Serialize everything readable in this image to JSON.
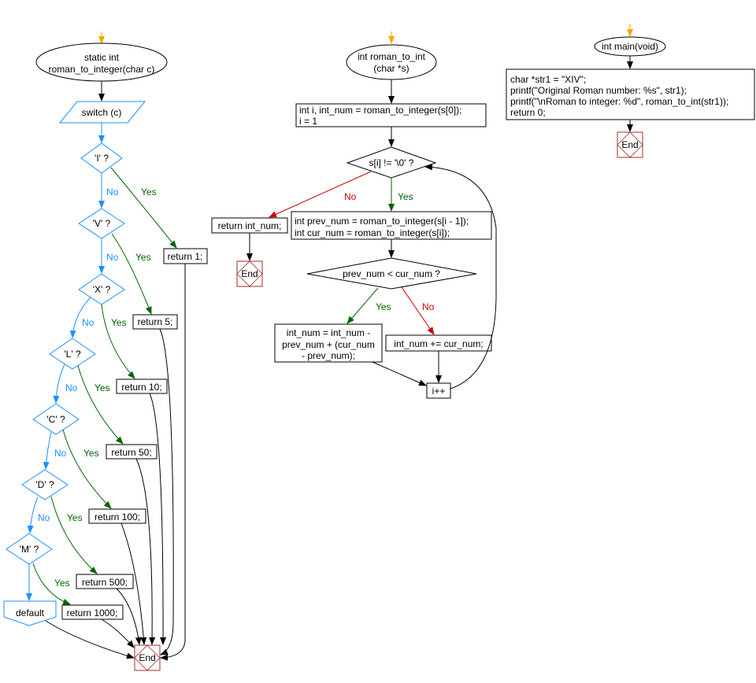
{
  "colors": {
    "no_left": "#1e90ff",
    "yes": "#006400",
    "no_right": "#cc0000",
    "end": "#a52a2a",
    "entry": "#ffa500"
  },
  "labels": {
    "yes": "Yes",
    "no": "No",
    "end": "End"
  },
  "roman_to_integer": {
    "start_line1": "static int",
    "start_line2": "roman_to_integer(char c)",
    "switch": "switch (c)",
    "cases": [
      "'I' ?",
      "'V' ?",
      "'X' ?",
      "'L' ?",
      "'C' ?",
      "'D' ?",
      "'M' ?"
    ],
    "returns": [
      "return 1;",
      "return 5;",
      "return 10;",
      "return 50;",
      "return 100;",
      "return 500;",
      "return 1000;"
    ],
    "default": "default"
  },
  "roman_to_int": {
    "start_line1": "int roman_to_int",
    "start_line2": "(char *s)",
    "init_line1": "int i, int_num = roman_to_integer(s[0]);",
    "init_line2": "i = 1",
    "loop_condition": "s[i] != '\\0' ?",
    "return": "return int_num;",
    "body_line1": "int prev_num = roman_to_integer(s[i - 1]);",
    "body_line2": "int cur_num = roman_to_integer(s[i]);",
    "compare": "prev_num < cur_num ?",
    "yes_line1": "int_num = int_num -",
    "yes_line2": "prev_num + (cur_num",
    "yes_line3": "- prev_num);",
    "no_stmt": "int_num += cur_num;",
    "increment": "i++"
  },
  "main": {
    "start": "int main(void)",
    "lines": [
      "char *str1 = \"XIV\";",
      "printf(\"Original Roman number: %s\", str1);",
      "printf(\"\\nRoman to integer: %d\", roman_to_int(str1));",
      "return 0;"
    ]
  }
}
